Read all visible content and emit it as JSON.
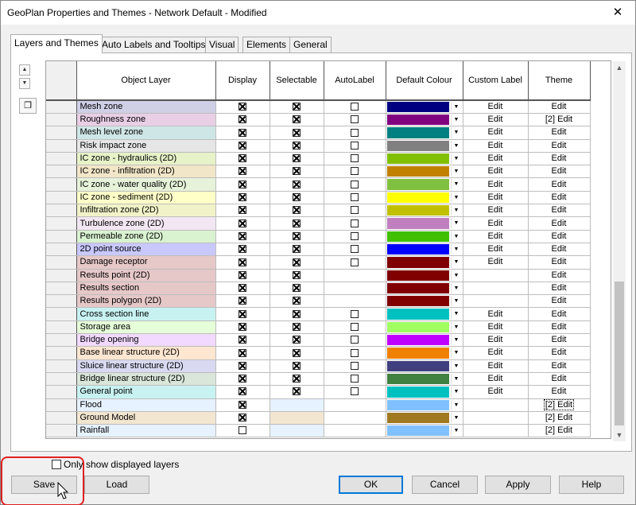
{
  "window": {
    "title": "GeoPlan Properties and Themes - Network Default - Modified",
    "close_glyph": "✕"
  },
  "tabs": [
    "Layers and Themes",
    "Auto Labels and Tooltips",
    "Visual",
    "Elements",
    "General"
  ],
  "side": {
    "up": "▲",
    "down": "▼",
    "copy": "❐"
  },
  "columns": [
    "Object Layer",
    "Display",
    "Selectable",
    "AutoLabel",
    "Default Colour",
    "Custom Label",
    "Theme"
  ],
  "edit_label": "Edit",
  "rows": [
    {
      "name": "Mesh zone",
      "bg": "#cfcfe6",
      "display": true,
      "selectable": true,
      "autolabel": false,
      "colour": "#000080",
      "custom": "Edit",
      "theme": "Edit"
    },
    {
      "name": "Roughness zone",
      "bg": "#e9cfe6",
      "display": true,
      "selectable": true,
      "autolabel": false,
      "colour": "#800080",
      "custom": "Edit",
      "theme": "[2] Edit"
    },
    {
      "name": "Mesh level zone",
      "bg": "#cfe6e6",
      "display": true,
      "selectable": true,
      "autolabel": false,
      "colour": "#008080",
      "custom": "Edit",
      "theme": "Edit"
    },
    {
      "name": "Risk impact zone",
      "bg": "#e6e6e6",
      "display": true,
      "selectable": true,
      "autolabel": false,
      "colour": "#808080",
      "custom": "Edit",
      "theme": "Edit"
    },
    {
      "name": "IC zone - hydraulics (2D)",
      "bg": "#e6f2c8",
      "display": true,
      "selectable": true,
      "autolabel": false,
      "colour": "#80c000",
      "custom": "Edit",
      "theme": "Edit"
    },
    {
      "name": "IC zone - infiltration (2D)",
      "bg": "#f2e6c8",
      "display": true,
      "selectable": true,
      "autolabel": false,
      "colour": "#c08000",
      "custom": "Edit",
      "theme": "Edit"
    },
    {
      "name": "IC zone - water quality (2D)",
      "bg": "#e6f2d9",
      "display": true,
      "selectable": true,
      "autolabel": false,
      "colour": "#80c040",
      "custom": "Edit",
      "theme": "Edit"
    },
    {
      "name": "IC zone - sediment (2D)",
      "bg": "#ffffc8",
      "display": true,
      "selectable": true,
      "autolabel": false,
      "colour": "#ffff00",
      "custom": "Edit",
      "theme": "Edit"
    },
    {
      "name": "Infiltration zone (2D)",
      "bg": "#f2f2c8",
      "display": true,
      "selectable": true,
      "autolabel": false,
      "colour": "#c0c000",
      "custom": "Edit",
      "theme": "Edit"
    },
    {
      "name": "Turbulence zone (2D)",
      "bg": "#f2e6f2",
      "display": true,
      "selectable": true,
      "autolabel": false,
      "colour": "#c080c0",
      "custom": "Edit",
      "theme": "Edit"
    },
    {
      "name": "Permeable zone (2D)",
      "bg": "#d9f2d0",
      "display": true,
      "selectable": true,
      "autolabel": false,
      "colour": "#40c000",
      "custom": "Edit",
      "theme": "Edit"
    },
    {
      "name": "2D point source",
      "bg": "#c8c8ff",
      "display": true,
      "selectable": true,
      "autolabel": false,
      "colour": "#0000ff",
      "custom": "Edit",
      "theme": "Edit"
    },
    {
      "name": "Damage receptor",
      "bg": "#e6c8c8",
      "display": true,
      "selectable": true,
      "autolabel": false,
      "colour": "#800000",
      "custom": "Edit",
      "theme": "Edit"
    },
    {
      "name": "Results point (2D)",
      "bg": "#e6c8c8",
      "display": true,
      "selectable": true,
      "autolabel": null,
      "colour": "#800000",
      "custom": "",
      "theme": "Edit"
    },
    {
      "name": "Results section",
      "bg": "#e6c8c8",
      "display": true,
      "selectable": true,
      "autolabel": null,
      "colour": "#800000",
      "custom": "",
      "theme": "Edit"
    },
    {
      "name": "Results polygon (2D)",
      "bg": "#e6c8c8",
      "display": true,
      "selectable": true,
      "autolabel": null,
      "colour": "#800000",
      "custom": "",
      "theme": "Edit"
    },
    {
      "name": "Cross section line",
      "bg": "#c8f2f2",
      "display": true,
      "selectable": true,
      "autolabel": false,
      "colour": "#00c0c0",
      "custom": "Edit",
      "theme": "Edit"
    },
    {
      "name": "Storage area",
      "bg": "#e6ffd9",
      "display": true,
      "selectable": true,
      "autolabel": false,
      "colour": "#a0ff60",
      "custom": "Edit",
      "theme": "Edit"
    },
    {
      "name": "Bridge opening",
      "bg": "#f2d9ff",
      "display": true,
      "selectable": true,
      "autolabel": false,
      "colour": "#c000ff",
      "custom": "Edit",
      "theme": "Edit"
    },
    {
      "name": "Base linear structure (2D)",
      "bg": "#ffe6d0",
      "display": true,
      "selectable": true,
      "autolabel": false,
      "colour": "#f08000",
      "custom": "Edit",
      "theme": "Edit"
    },
    {
      "name": "Sluice linear structure (2D)",
      "bg": "#d9d9f2",
      "display": true,
      "selectable": true,
      "autolabel": false,
      "colour": "#404080",
      "custom": "Edit",
      "theme": "Edit"
    },
    {
      "name": "Bridge linear structure (2D)",
      "bg": "#d9e6d9",
      "display": true,
      "selectable": true,
      "autolabel": false,
      "colour": "#408040",
      "custom": "Edit",
      "theme": "Edit"
    },
    {
      "name": "General point",
      "bg": "#c8f2f2",
      "display": true,
      "selectable": true,
      "autolabel": false,
      "colour": "#00c0c0",
      "custom": "Edit",
      "theme": "Edit"
    },
    {
      "name": "Flood",
      "bg": "#e6f2ff",
      "display": true,
      "selectable": null,
      "autolabel": null,
      "colour": "#80c0ff",
      "custom": "",
      "theme": "[2] Edit",
      "theme_boxed": true
    },
    {
      "name": "Ground Model",
      "bg": "#f2e6d0",
      "display": true,
      "selectable": null,
      "autolabel": null,
      "colour": "#a07820",
      "custom": "",
      "theme": "[2] Edit"
    },
    {
      "name": "Rainfall",
      "bg": "#e6f2ff",
      "display": false,
      "selectable": null,
      "autolabel": null,
      "colour": "#80c0ff",
      "custom": "",
      "theme": "[2] Edit"
    }
  ],
  "only_show": "Only show displayed layers",
  "buttons": {
    "save": "Save",
    "load": "Load",
    "ok": "OK",
    "cancel": "Cancel",
    "apply": "Apply",
    "help": "Help"
  }
}
